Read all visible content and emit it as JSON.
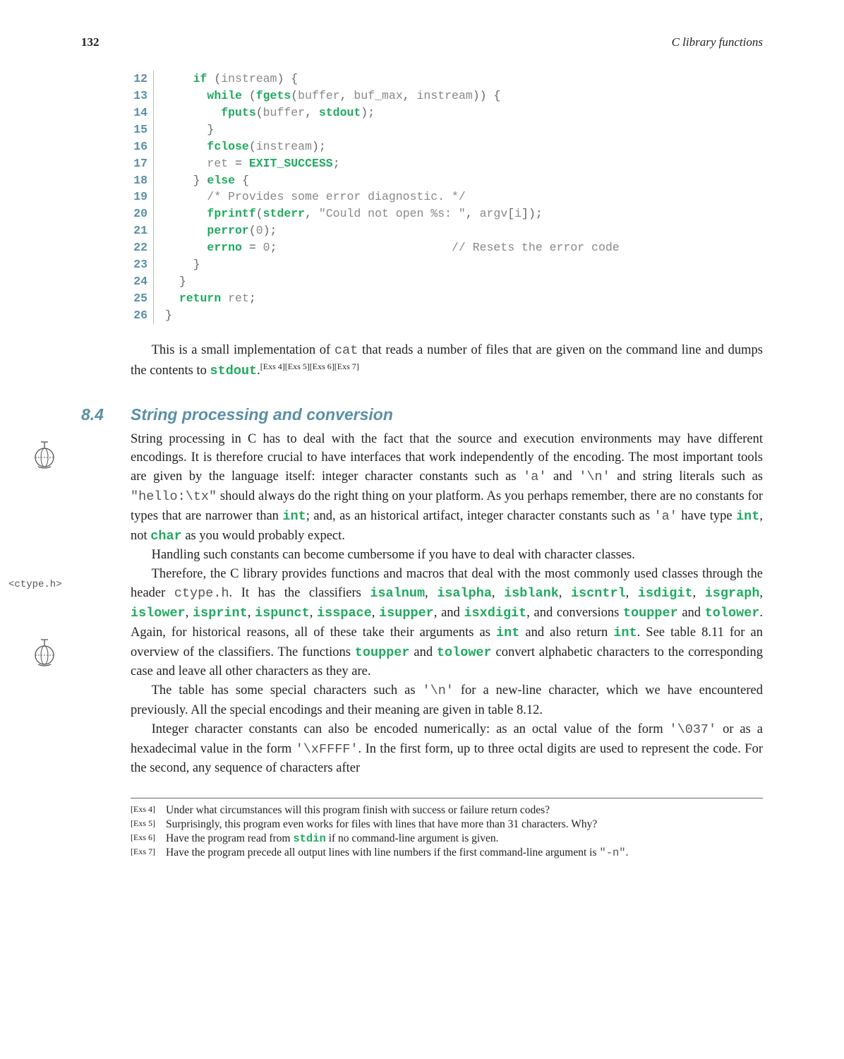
{
  "header": {
    "page_number": "132",
    "chapter_title": "C library functions"
  },
  "code": {
    "lines": [
      {
        "n": "12",
        "html": "    <span class='kw'>if</span> <span class='br'>(</span><span class='id'>instream</span><span class='br'>) {</span>"
      },
      {
        "n": "13",
        "html": "      <span class='kw'>while</span> <span class='br'>(</span><span class='fn'>fgets</span><span class='br'>(</span><span class='id'>buffer</span><span class='br'>,</span> <span class='id'>buf_max</span><span class='br'>,</span> <span class='id'>instream</span><span class='br'>)) {</span>"
      },
      {
        "n": "14",
        "html": "        <span class='fn'>fputs</span><span class='br'>(</span><span class='id'>buffer</span><span class='br'>,</span> <span class='fn'>stdout</span><span class='br'>);</span>"
      },
      {
        "n": "15",
        "html": "      <span class='br'>}</span>"
      },
      {
        "n": "16",
        "html": "      <span class='fn'>fclose</span><span class='br'>(</span><span class='id'>instream</span><span class='br'>);</span>"
      },
      {
        "n": "17",
        "html": "      <span class='id'>ret</span> <span class='br'>=</span> <span class='fn'>EXIT_SUCCESS</span><span class='br'>;</span>"
      },
      {
        "n": "18",
        "html": "    <span class='br'>}</span> <span class='kw'>else</span> <span class='br'>{</span>"
      },
      {
        "n": "19",
        "html": "      <span class='cm'>/* Provides some error diagnostic. */</span>"
      },
      {
        "n": "20",
        "html": "      <span class='fn'>fprintf</span><span class='br'>(</span><span class='fn'>stderr</span><span class='br'>,</span> <span class='st'>\"Could not open %s: \"</span><span class='br'>,</span> <span class='id'>argv</span><span class='br'>[</span><span class='id'>i</span><span class='br'>]);</span>"
      },
      {
        "n": "21",
        "html": "      <span class='fn'>perror</span><span class='br'>(</span><span class='nm'>0</span><span class='br'>);</span>"
      },
      {
        "n": "22",
        "html": "      <span class='fn'>errno</span> <span class='br'>=</span> <span class='nm'>0</span><span class='br'>;</span>                         <span class='cm'>// Resets the error code</span>"
      },
      {
        "n": "23",
        "html": "    <span class='br'>}</span>"
      },
      {
        "n": "24",
        "html": "  <span class='br'>}</span>"
      },
      {
        "n": "25",
        "html": "  <span class='kw'>return</span> <span class='id'>ret</span><span class='br'>;</span>"
      },
      {
        "n": "26",
        "html": "<span class='br'>}</span>"
      }
    ]
  },
  "para1": {
    "html": "This is a small implementation of <span class='mono'>cat</span> that reads a number of files that are given on the command line and dumps the contents to <span class='mono-kw'>stdout</span>.<span class='sup-ref'>[Exs 4][Exs 5][Exs 6][Exs 7]</span>"
  },
  "section": {
    "number": "8.4",
    "title": "String processing and conversion"
  },
  "para2": {
    "html": "String processing in C has to deal with the fact that the source and execution environments may have different encodings. It is therefore crucial to have interfaces that work independently of the encoding. The most important tools are given by the language itself: integer character constants such as <span class='mono'>'a'</span> and <span class='mono'>'\\n'</span> and string literals such as <span class='mono'>\"hello:\\tx\"</span> should always do the right thing on your platform. As you perhaps remember, there are no constants for types that are narrower than <span class='mono-kw'>int</span>; and, as an historical artifact, integer character constants such as <span class='mono'>'a'</span> have type <span class='mono-kw'>int</span>, not <span class='mono-kw'>char</span> as you would probably expect."
  },
  "para3": {
    "html": "Handling such constants can become cumbersome if you have to deal with character classes."
  },
  "para4": {
    "html": "Therefore, the C library provides functions and macros that deal with the most commonly used classes through the header <span class='mono'>ctype.h</span>. It has the classifiers <span class='mono-kw'>isalnum</span>, <span class='mono-kw'>isalpha</span>, <span class='mono-kw'>isblank</span>, <span class='mono-kw'>iscntrl</span>, <span class='mono-kw'>isdigit</span>, <span class='mono-kw'>isgraph</span>, <span class='mono-kw'>islower</span>, <span class='mono-kw'>isprint</span>, <span class='mono-kw'>ispunct</span>, <span class='mono-kw'>isspace</span>, <span class='mono-kw'>isupper</span>, and <span class='mono-kw'>isxdigit</span>, and conversions <span class='mono-kw'>toupper</span> and <span class='mono-kw'>tolower</span>. Again, for historical reasons, all of these take their arguments as <span class='mono-kw'>int</span> and also return <span class='mono-kw'>int</span>. See table 8.11 for an overview of the classifiers. The functions <span class='mono-kw'>toupper</span> and <span class='mono-kw'>tolower</span> convert alphabetic characters to the corresponding case and leave all other characters as they are."
  },
  "para5": {
    "html": "The table has some special characters such as <span class='mono'>'\\n'</span> for a new-line character, which we have encountered previously. All the special encodings and their meaning are given in table 8.12."
  },
  "para6": {
    "html": "Integer character constants can also be encoded numerically: as an octal value of the form <span class='mono'>'\\037'</span> or as a hexadecimal value in the form <span class='mono'>'\\xFFFF'</span>. In the first form, up to three octal digits are used to represent the code. For the second, any sequence of characters after"
  },
  "margin_note": {
    "text": "<ctype.h>"
  },
  "footnotes": [
    {
      "label": "[Exs 4]",
      "text": "Under what circumstances will this program finish with success or failure return codes?"
    },
    {
      "label": "[Exs 5]",
      "text": "Surprisingly, this program even works for files with lines that have more than 31 characters. Why?"
    },
    {
      "label": "[Exs 6]",
      "html": "Have the program read from <span class='mono-kw'>stdin</span> if no command-line argument is given."
    },
    {
      "label": "[Exs 7]",
      "html": "Have the program precede all output lines with line numbers if the first command-line argument is <span class='mono'>\"-n\"</span>."
    }
  ]
}
